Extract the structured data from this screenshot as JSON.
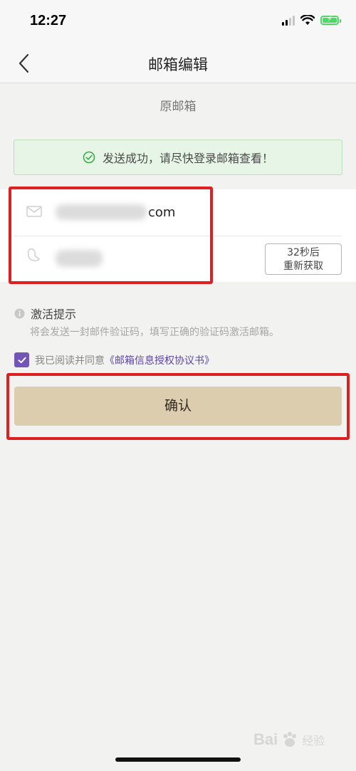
{
  "status_bar": {
    "time": "12:27"
  },
  "nav": {
    "title": "邮箱编辑"
  },
  "section_label": "原邮箱",
  "toast": {
    "message": "发送成功，请尽快登录邮箱查看！"
  },
  "form": {
    "email_suffix": "com",
    "resend_countdown": "32秒后",
    "resend_label": "重新获取"
  },
  "hint": {
    "title": "激活提示",
    "text": "将会发送一封邮件验证码，填写正确的验证码激活邮箱。"
  },
  "agreement": {
    "prefix": "我已阅读并同意",
    "link": "《邮箱信息授权协议书》",
    "checked": true
  },
  "confirm_button": "确认",
  "watermark": {
    "brand": "Bai",
    "suffix": "经验"
  },
  "colors": {
    "accent_purple": "#7355b8",
    "confirm_bg": "#dccdae",
    "toast_bg": "#e6f5e6",
    "highlight_red": "#e02020",
    "battery_green": "#4cd964"
  }
}
